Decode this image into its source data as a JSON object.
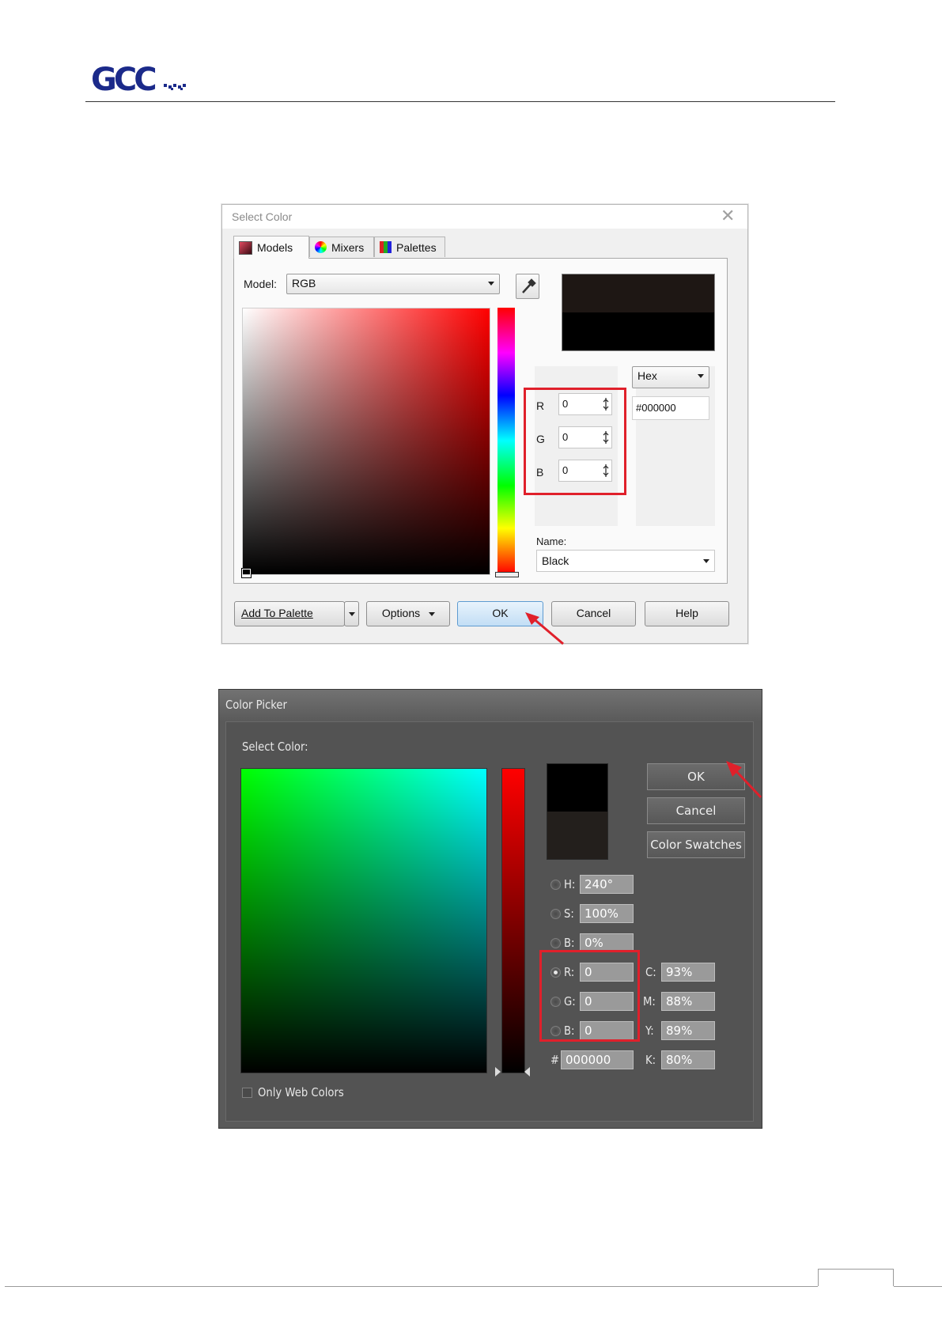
{
  "header": {
    "logo_text": "GCC"
  },
  "dialog1": {
    "title": "Select Color",
    "tabs": [
      {
        "label": "Models",
        "icon": "models-icon"
      },
      {
        "label": "Mixers",
        "icon": "mixers-icon"
      },
      {
        "label": "Palettes",
        "icon": "palettes-icon"
      }
    ],
    "model_label": "Model:",
    "model_value": "RGB",
    "format_value": "Hex",
    "hex_value": "#000000",
    "r_label": "R",
    "r_value": "0",
    "g_label": "G",
    "g_value": "0",
    "b_label": "B",
    "b_value": "0",
    "name_label": "Name:",
    "name_value": "Black",
    "buttons": {
      "add_to_palette": "Add To Palette",
      "options": "Options",
      "ok": "OK",
      "cancel": "Cancel",
      "help": "Help"
    },
    "colors": {
      "preview_top": "#1e1714",
      "preview_bottom": "#000000",
      "highlight": "#e0202b"
    }
  },
  "dialog2": {
    "title": "Color Picker",
    "select_color_label": "Select Color:",
    "buttons": {
      "ok": "OK",
      "cancel": "Cancel",
      "swatches": "Color Swatches"
    },
    "fields": {
      "h_label": "H:",
      "h_value": "240°",
      "s_label": "S:",
      "s_value": "100%",
      "bri_label": "B:",
      "bri_value": "0%",
      "r_label": "R:",
      "r_value": "0",
      "g_label": "G:",
      "g_value": "0",
      "b_label": "B:",
      "b_value": "0",
      "hash_label": "#",
      "hex_value": "000000",
      "c_label": "C:",
      "c_value": "93%",
      "m_label": "M:",
      "m_value": "88%",
      "y_label": "Y:",
      "y_value": "89%",
      "k_label": "K:",
      "k_value": "80%"
    },
    "web_colors_label": "Only Web Colors",
    "colors": {
      "preview_top": "#000000",
      "preview_bottom": "#231f1c"
    }
  }
}
